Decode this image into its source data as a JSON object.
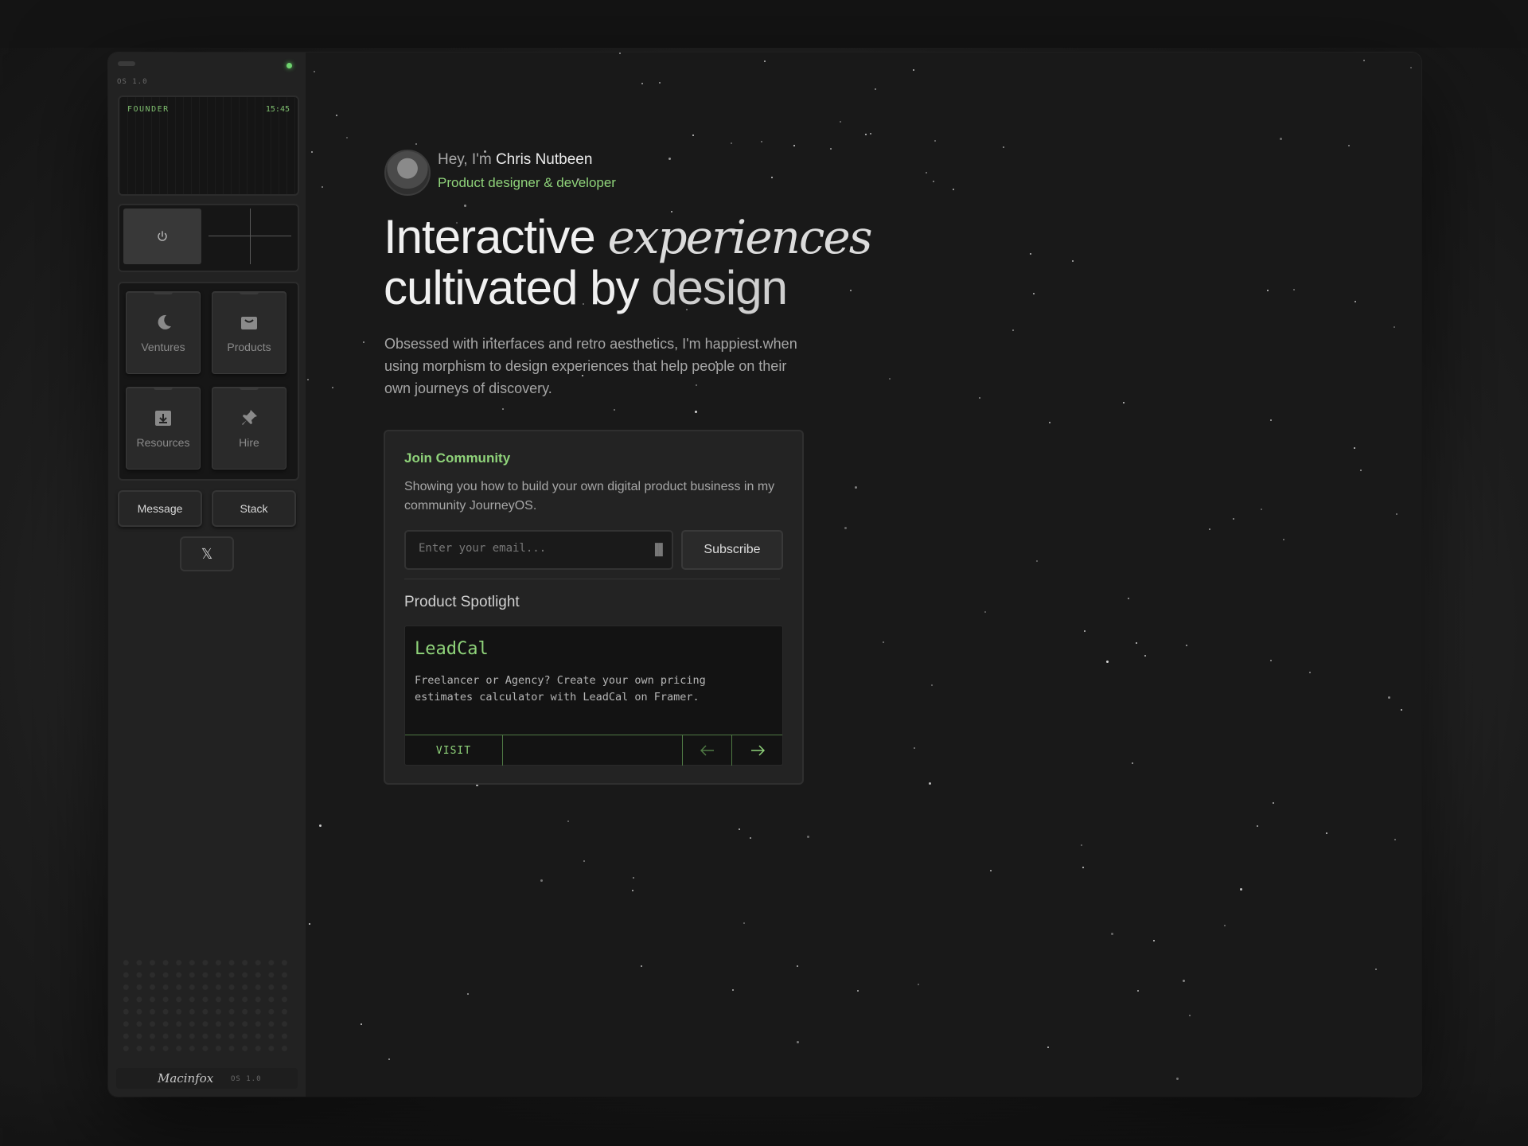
{
  "sidebar": {
    "os_version": "OS 1.0",
    "screen_label": "FOUNDER",
    "screen_time": "15:45",
    "power_icon": "power-icon",
    "tiles": [
      {
        "label": "Ventures",
        "icon": "moon-icon"
      },
      {
        "label": "Products",
        "icon": "bag-icon"
      },
      {
        "label": "Resources",
        "icon": "download-box-icon"
      },
      {
        "label": "Hire",
        "icon": "pin-icon"
      }
    ],
    "message_label": "Message",
    "stack_label": "Stack",
    "x_label": "𝕏",
    "brand_name": "Macinfox",
    "brand_version": "OS 1.0"
  },
  "hero": {
    "greeting": "Hey, I'm ",
    "name": "Chris Nutbeen",
    "role": "Product designer & developer",
    "headline_1": "Interactive ",
    "headline_1_em": "experiences",
    "headline_2a": "cultivated by ",
    "headline_2b": "design",
    "description": "Obsessed with interfaces and retro aesthetics, I'm happiest when using morphism to design experiences that help people on their own journeys of discovery."
  },
  "community": {
    "title": "Join Community",
    "description": "Showing you how to build your own digital product business in my community JourneyOS.",
    "email_placeholder": "Enter your email...",
    "subscribe_label": "Subscribe"
  },
  "spotlight": {
    "title": "Product Spotlight",
    "product_name": "LeadCal",
    "product_description": "Freelancer or Agency? Create your own pricing estimates calculator with LeadCal on Framer.",
    "visit_label": "VISIT",
    "prev_icon": "arrow-left-icon",
    "next_icon": "arrow-right-icon"
  },
  "colors": {
    "accent": "#8fd37a",
    "background": "#191919",
    "sidebar": "#222222"
  }
}
